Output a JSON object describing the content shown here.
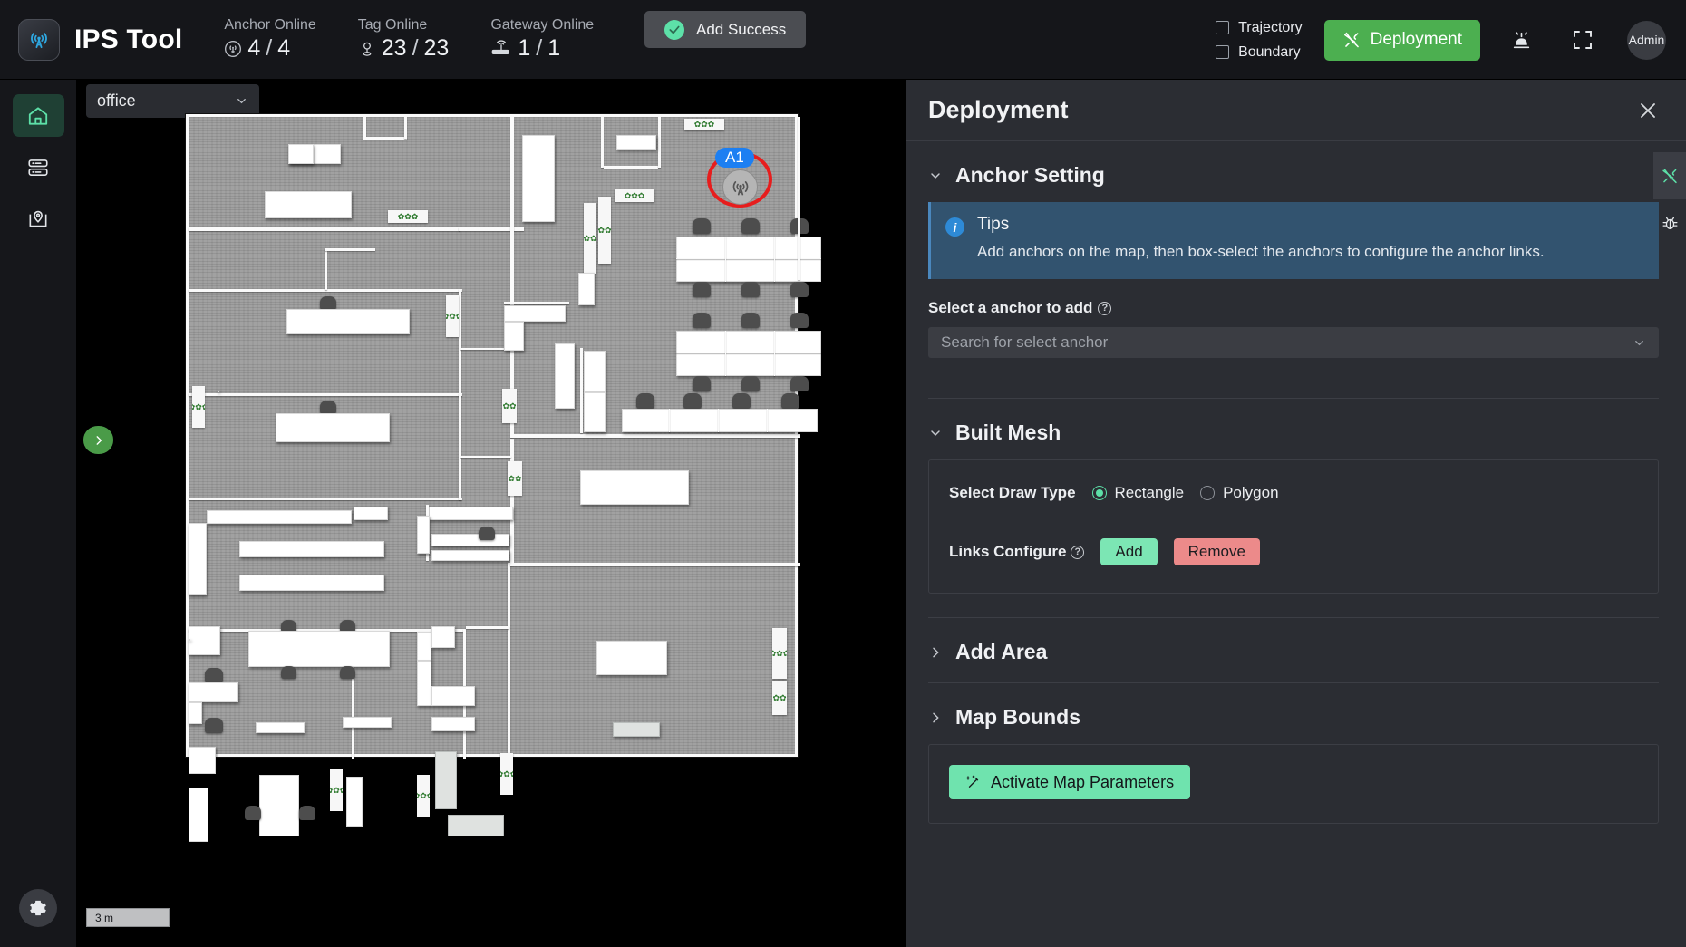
{
  "header": {
    "brand_title": "IPS Tool",
    "brand_icon": "signal-tower-icon",
    "stats": [
      {
        "label": "Anchor Online",
        "icon": "anchor-icon",
        "online": "4",
        "separator": "/",
        "total": "4"
      },
      {
        "label": "Tag Online",
        "icon": "tag-pin-icon",
        "online": "23",
        "separator": "/",
        "total": "23"
      },
      {
        "label": "Gateway Online",
        "icon": "gateway-router-icon",
        "online": "1",
        "separator": "/",
        "total": "1"
      }
    ],
    "toast": {
      "text": "Add Success",
      "icon": "check-circle-icon",
      "color": "#5de0a8"
    },
    "checkboxes": [
      {
        "label": "Trajectory",
        "checked": false
      },
      {
        "label": "Boundary",
        "checked": false
      }
    ],
    "deployment_button": {
      "label": "Deployment",
      "icon": "tools-icon",
      "color": "#4caf50"
    },
    "alarm_icon": "alarm-bell-icon",
    "fullscreen_icon": "fullscreen-icon",
    "avatar_label": "Admin"
  },
  "sidebar": {
    "items": [
      {
        "name": "home",
        "icon": "home-icon",
        "active": true
      },
      {
        "name": "devices",
        "icon": "server-stack-icon",
        "active": false
      },
      {
        "name": "map",
        "icon": "map-pin-icon",
        "active": false
      }
    ],
    "settings_icon": "gear-icon"
  },
  "map": {
    "floor_select_value": "office",
    "floor_select_icon": "chevron-down-icon",
    "collapse_arrow_icon": "chevron-right-icon",
    "scale_label": "3 m",
    "anchor": {
      "label": "A1",
      "icon": "anchor-signal-icon",
      "highlight_color": "#e71d1d",
      "tag_color": "#1c7ff2"
    }
  },
  "panel": {
    "title": "Deployment",
    "close_icon": "close-icon",
    "sections": {
      "anchor_setting": {
        "title": "Anchor Setting",
        "expanded": true,
        "chevron": "chevron-down-icon",
        "tips": {
          "icon": "info-icon",
          "title": "Tips",
          "body": "Add anchors on the map, then box-select the anchors to configure the anchor links."
        },
        "field_label": "Select a anchor to add",
        "field_help_icon": "question-circle-icon",
        "search_placeholder": "Search for select anchor",
        "search_value": "",
        "search_chevron": "chevron-down-icon"
      },
      "built_mesh": {
        "title": "Built Mesh",
        "expanded": true,
        "chevron": "chevron-down-icon",
        "draw_type_label": "Select Draw Type",
        "draw_type_options": [
          {
            "label": "Rectangle",
            "selected": true
          },
          {
            "label": "Polygon",
            "selected": false
          }
        ],
        "links_configure_label": "Links Configure",
        "links_help_icon": "question-circle-icon",
        "add_button": "Add",
        "remove_button": "Remove"
      },
      "add_area": {
        "title": "Add Area",
        "expanded": false,
        "chevron": "chevron-right-icon"
      },
      "map_bounds": {
        "title": "Map Bounds",
        "expanded": false,
        "chevron": "chevron-right-icon"
      }
    },
    "activate_button": {
      "label": "Activate Map Parameters",
      "icon": "magic-wand-icon",
      "color": "#6fe3ae"
    }
  },
  "toolrail": {
    "items": [
      {
        "name": "deployment-tools",
        "icon": "tools-icon",
        "active": true
      },
      {
        "name": "debug",
        "icon": "bug-icon",
        "active": false
      }
    ]
  }
}
